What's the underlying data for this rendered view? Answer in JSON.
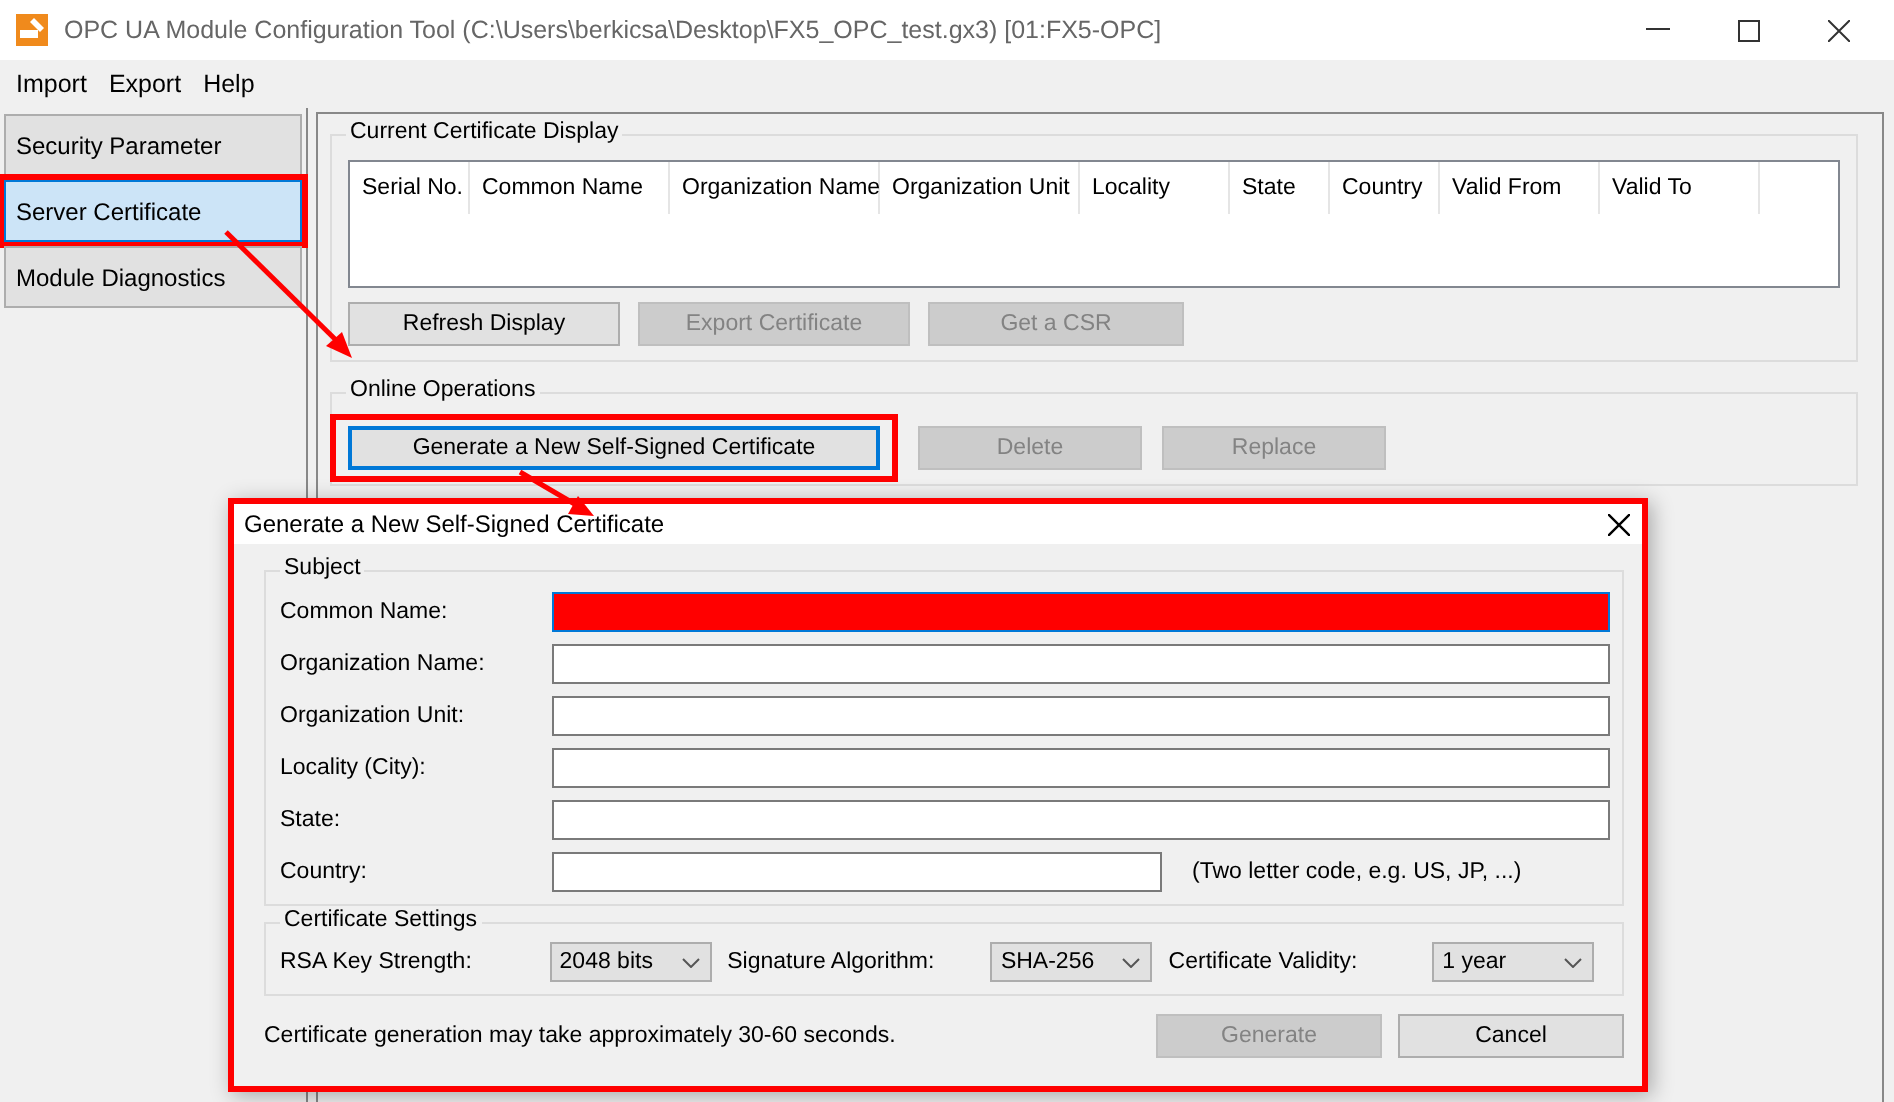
{
  "window": {
    "title": "OPC UA Module Configuration Tool (C:\\Users\\berkicsa\\Desktop\\FX5_OPC_test.gx3) [01:FX5-OPC]"
  },
  "menu": [
    "Import",
    "Export",
    "Help"
  ],
  "sidebar": {
    "items": [
      {
        "label": "Security Parameter",
        "selected": false,
        "highlighted": false
      },
      {
        "label": "Server Certificate",
        "selected": true,
        "highlighted": true
      },
      {
        "label": "Module Diagnostics",
        "selected": false,
        "highlighted": false
      }
    ]
  },
  "certificate_display": {
    "title": "Current Certificate Display",
    "columns": [
      "Serial No.",
      "Common Name",
      "Organization Name",
      "Organization Unit",
      "Locality",
      "State",
      "Country",
      "Valid From",
      "Valid To"
    ],
    "buttons": [
      {
        "label": "Refresh Display",
        "disabled": false
      },
      {
        "label": "Export Certificate",
        "disabled": true
      },
      {
        "label": "Get a CSR",
        "disabled": true
      }
    ]
  },
  "online_operations": {
    "title": "Online Operations",
    "buttons": [
      {
        "label": "Generate a New Self-Signed Certificate",
        "disabled": false,
        "focused": true,
        "highlighted": true
      },
      {
        "label": "Delete",
        "disabled": true,
        "focused": false,
        "highlighted": false
      },
      {
        "label": "Replace",
        "disabled": true,
        "focused": false,
        "highlighted": false
      }
    ]
  },
  "dialog": {
    "title": "Generate a New Self-Signed Certificate",
    "highlighted": true,
    "subject": {
      "title": "Subject",
      "fields": [
        {
          "label": "Common Name:",
          "redacted": true,
          "focused": true
        },
        {
          "label": "Organization Name:",
          "redacted": false,
          "focused": false
        },
        {
          "label": "Organization Unit:",
          "redacted": false,
          "focused": false
        },
        {
          "label": "Locality (City):",
          "redacted": false,
          "focused": false
        },
        {
          "label": "State:",
          "redacted": false,
          "focused": false
        },
        {
          "label": "Country:",
          "redacted": false,
          "focused": false,
          "note": "(Two letter code, e.g. US, JP, ...)"
        }
      ]
    },
    "settings": {
      "title": "Certificate Settings",
      "items": [
        {
          "label": "RSA Key Strength:",
          "value": "2048 bits"
        },
        {
          "label": "Signature Algorithm:",
          "value": "SHA-256"
        },
        {
          "label": "Certificate Validity:",
          "value": "1 year"
        }
      ]
    },
    "note": "Certificate generation may take approximately 30-60 seconds.",
    "buttons": [
      {
        "label": "Generate",
        "disabled": true
      },
      {
        "label": "Cancel",
        "disabled": false
      }
    ]
  }
}
